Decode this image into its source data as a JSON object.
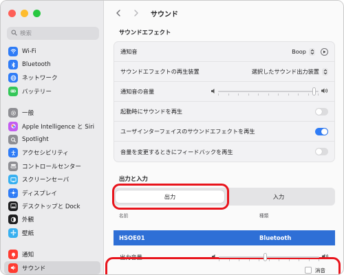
{
  "sidebar": {
    "search_placeholder": "検索",
    "items": [
      {
        "label": "Wi-Fi",
        "icon": "wifi-icon",
        "color": "#2f7cf6"
      },
      {
        "label": "Bluetooth",
        "icon": "bluetooth-icon",
        "color": "#2f7cf6"
      },
      {
        "label": "ネットワーク",
        "icon": "globe-icon",
        "color": "#2f7cf6"
      },
      {
        "label": "バッテリー",
        "icon": "battery-icon",
        "color": "#34c759"
      },
      {
        "label": "一般",
        "icon": "gear-icon",
        "color": "#8e8e93"
      },
      {
        "label": "Apple Intelligence と Siri",
        "icon": "siri-icon",
        "color": "#c35cf0"
      },
      {
        "label": "Spotlight",
        "icon": "magnifier-icon",
        "color": "#8e8e93"
      },
      {
        "label": "アクセシビリティ",
        "icon": "accessibility-icon",
        "color": "#2f7cf6"
      },
      {
        "label": "コントロールセンター",
        "icon": "control-center-icon",
        "color": "#8e8e93"
      },
      {
        "label": "スクリーンセーバ",
        "icon": "screensaver-icon",
        "color": "#38b0f0"
      },
      {
        "label": "ディスプレイ",
        "icon": "display-icon",
        "color": "#2f7cf6"
      },
      {
        "label": "デスクトップと Dock",
        "icon": "dock-icon",
        "color": "#1d1d1f"
      },
      {
        "label": "外観",
        "icon": "appearance-icon",
        "color": "#1d1d1f"
      },
      {
        "label": "壁紙",
        "icon": "wallpaper-icon",
        "color": "#38b0f0"
      },
      {
        "label": "通知",
        "icon": "bell-icon",
        "color": "#ff3b30"
      },
      {
        "label": "サウンド",
        "icon": "speaker-icon",
        "color": "#ff3b30"
      }
    ],
    "active_index": 15
  },
  "header": {
    "title": "サウンド"
  },
  "sound_effects": {
    "section_title": "サウンドエフェクト",
    "alert_sound_label": "通知音",
    "alert_sound_value": "Boop",
    "play_device_label": "サウンドエフェクトの再生装置",
    "play_device_value": "選択したサウンド出力装置",
    "alert_volume_label": "通知音の音量",
    "alert_volume_level": 0.97,
    "startup_label": "起動時にサウンドを再生",
    "startup_on": false,
    "ui_effects_label": "ユーザインターフェイスのサウンドエフェクトを再生",
    "ui_effects_on": true,
    "feedback_label": "音量を変更するときにフィードバックを再生",
    "feedback_on": false
  },
  "io": {
    "section_title": "出力と入力",
    "tab_output": "出力",
    "tab_input": "入力",
    "col_name": "名前",
    "col_type": "種類",
    "device_name": "HSOE01",
    "device_type": "Bluetooth",
    "output_volume_label": "出力音量",
    "output_volume_level": 0.46,
    "mute_label": "消音"
  },
  "colors": {
    "accent": "#2f7cf6",
    "highlight_ring": "#e8141c",
    "selected_row": "#2e6fd6"
  }
}
